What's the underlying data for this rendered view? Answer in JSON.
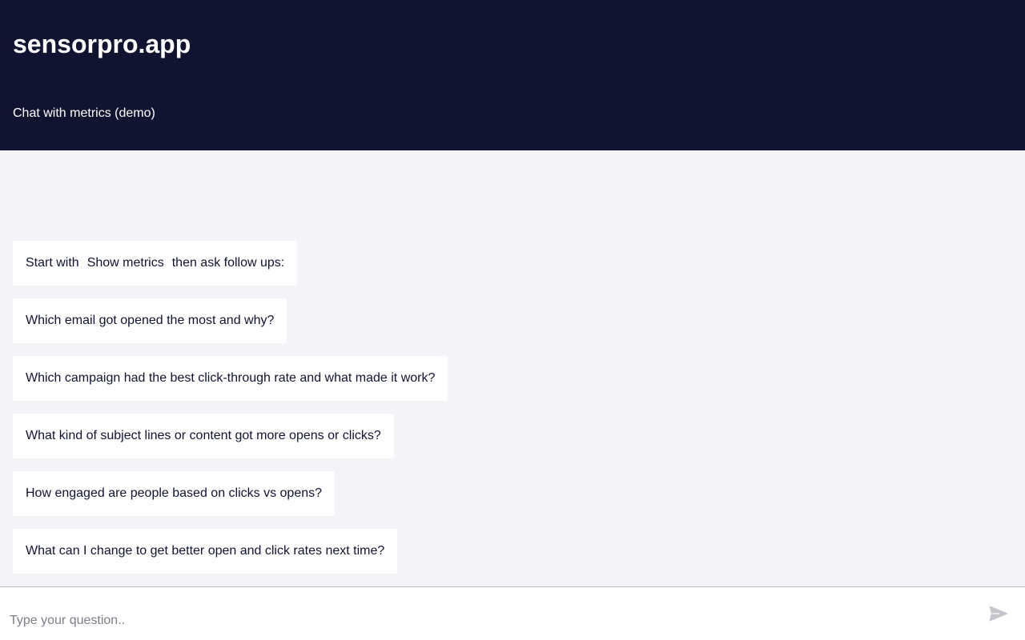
{
  "header": {
    "app_title": "sensorpro.app",
    "subtitle": "Chat with metrics (demo)"
  },
  "intro": {
    "prefix": "Start with",
    "command": "Show metrics",
    "suffix": "then ask follow ups:"
  },
  "suggestions": [
    "Which email got opened the most and why?",
    "Which campaign had the best click-through rate and what made it work?",
    "What kind of subject lines or content got more opens or clicks?",
    "How engaged are people based on clicks vs opens?",
    "What can I change to get better open and click rates next time?"
  ],
  "input": {
    "placeholder": "Type your question..",
    "value": ""
  },
  "send": {
    "icon": "send-icon",
    "color": "#c4c6cc"
  },
  "colors": {
    "header_bg": "#111431",
    "chat_bg": "#f3f4f8",
    "bubble_bg": "#ffffff",
    "text": "#111431"
  }
}
